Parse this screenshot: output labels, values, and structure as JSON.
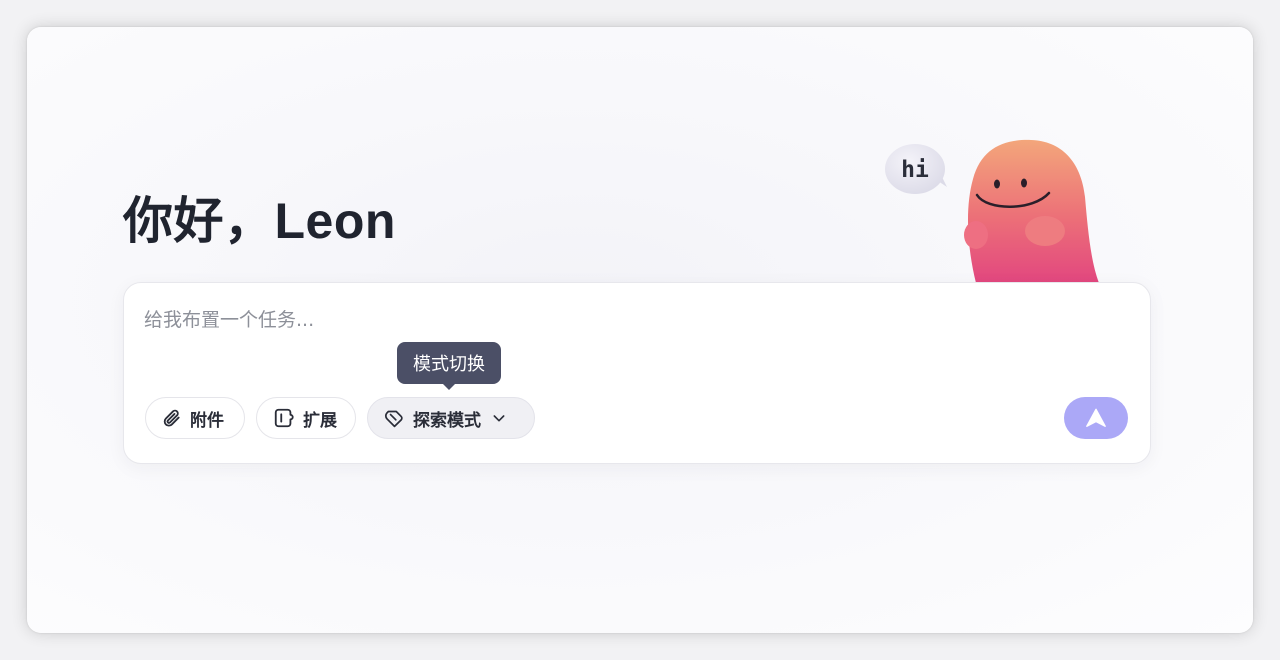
{
  "greeting": {
    "text": "你好，Leon"
  },
  "mascot": {
    "bubble_text": "hi"
  },
  "composer": {
    "placeholder": "给我布置一个任务...",
    "value": "",
    "toolbar": {
      "attach_label": "附件",
      "expand_label": "扩展",
      "mode_label": "探索模式",
      "mode_tooltip": "模式切换"
    }
  },
  "colors": {
    "send_button": "#aba8f7",
    "tooltip_bg": "#4b4f66",
    "mascot_top": "#f3a67b",
    "mascot_bottom": "#e2477f"
  },
  "icons": {
    "attach": "paperclip-icon",
    "expand": "plugin-icon",
    "mode": "compass-icon",
    "mode_dropdown": "chevron-down-icon",
    "send": "arrow-up-icon"
  }
}
